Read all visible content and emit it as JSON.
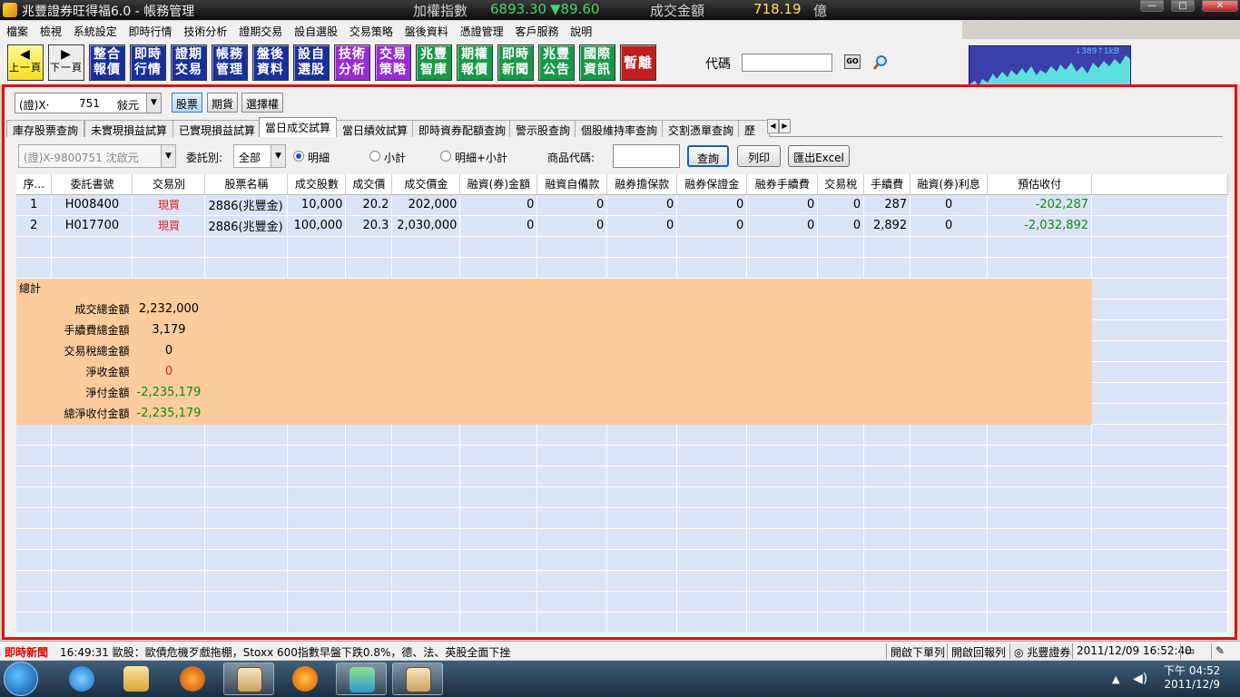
{
  "titlebar": {
    "title": "兆豐證券旺得福6.0 - 帳務管理",
    "index_label": "加權指數",
    "index_value": "6893.30",
    "index_change": "▼89.60",
    "volume_label": "成交金額",
    "volume_value": "718.19",
    "volume_unit": "億"
  },
  "window_controls": {
    "minimize": "—",
    "maximize": "□",
    "close": "✕"
  },
  "menu": [
    "檔案",
    "檢視",
    "系統設定",
    "即時行情",
    "技術分析",
    "證期交易",
    "設自選股",
    "交易策略",
    "盤後資料",
    "憑證管理",
    "客戶服務",
    "說明"
  ],
  "toolbar": {
    "prev": "上一頁",
    "next": "下一頁",
    "buttons": [
      {
        "label": "整合報價",
        "color": "#1b2f9c"
      },
      {
        "label": "即時行情",
        "color": "#1b2f9c"
      },
      {
        "label": "證期交易",
        "color": "#1b2f9c"
      },
      {
        "label": "帳務管理",
        "color": "#1b2f9c"
      },
      {
        "label": "盤後資料",
        "color": "#1b2f9c"
      },
      {
        "label": "設自選股",
        "color": "#1b2f9c"
      },
      {
        "label": "技術分析",
        "color": "#9a2bd6"
      },
      {
        "label": "交易策略",
        "color": "#9a2bd6"
      },
      {
        "label": "兆豐智庫",
        "color": "#17994a"
      },
      {
        "label": "期權報價",
        "color": "#17994a"
      },
      {
        "label": "即時新聞",
        "color": "#17994a"
      },
      {
        "label": "兆豐公告",
        "color": "#17994a"
      },
      {
        "label": "國際資訊",
        "color": "#17994a"
      },
      {
        "label": "暫離",
        "color": "#c21d1d"
      }
    ],
    "code_label": "代碼",
    "code_value": "",
    "go_label": "GO",
    "chart_label": "↓389↑1kB"
  },
  "account": {
    "prefix": "(證)X·",
    "mid": "751",
    "suffix": "敍元",
    "market_tabs": [
      "股票",
      "期貨",
      "選擇權"
    ],
    "active_market": 0
  },
  "function_tabs": [
    "庫存股票查詢",
    "未實現損益試算",
    "已實現損益試算",
    "當日成交試算",
    "當日績效試算",
    "即時資券配額查詢",
    "警示股查詢",
    "個股維持率查詢",
    "交割憑單查詢",
    "歷史"
  ],
  "active_function_tab": 3,
  "filter": {
    "account_value": "(證)X-9800751 沈啟元",
    "type_label": "委託別:",
    "type_value": "全部",
    "radio_detail": "明細",
    "radio_subtotal": "小計",
    "radio_both": "明細+小計",
    "selected_radio": "detail",
    "product_label": "商品代碼:",
    "product_value": "",
    "query_button": "查詢",
    "print_button": "列印",
    "export_button": "匯出Excel"
  },
  "table": {
    "columns": [
      "序...",
      "委託書號",
      "交易別",
      "股票名稱",
      "成交股數",
      "成交價",
      "成交價金",
      "融資(券)金額",
      "融資自備款",
      "融券擔保款",
      "融券保證金",
      "融券手續費",
      "交易稅",
      "手續費",
      "融資(券)利息",
      "預估收付"
    ],
    "rows": [
      [
        "1",
        "H008400",
        "現買",
        "2886(兆豐金)",
        "10,000",
        "20.2",
        "202,000",
        "0",
        "0",
        "0",
        "0",
        "0",
        "0",
        "287",
        "0",
        "-202,287"
      ],
      [
        "2",
        "H017700",
        "現買",
        "2886(兆豐金)",
        "100,000",
        "20.3",
        "2,030,000",
        "0",
        "0",
        "0",
        "0",
        "0",
        "0",
        "2,892",
        "0",
        "-2,032,892"
      ]
    ]
  },
  "summary": {
    "title": "總計",
    "items": [
      {
        "label": "成交總金額",
        "value": "2,232,000",
        "tone": "normal"
      },
      {
        "label": "手續費總金額",
        "value": "3,179",
        "tone": "normal"
      },
      {
        "label": "交易稅總金額",
        "value": "0",
        "tone": "normal"
      },
      {
        "label": "淨收金額",
        "value": "0",
        "tone": "red"
      },
      {
        "label": "淨付金額",
        "value": "-2,235,179",
        "tone": "green"
      },
      {
        "label": "總淨收付金額",
        "value": "-2,235,179",
        "tone": "green"
      }
    ]
  },
  "statusbar": {
    "news_label": "即時新聞",
    "news_text": "16:49:31 歐股：歐債危機歹戲拖棚，Stoxx 600指數早盤下跌0.8%，德、法、英股全面下挫",
    "open_orders": "開啟下單列",
    "open_report": "開啟回報列",
    "broker": "兆豐證券",
    "datetime": "2011/12/09 16:52:40"
  },
  "taskbar": {
    "time": "下午 04:52",
    "date": "2011/12/9"
  }
}
